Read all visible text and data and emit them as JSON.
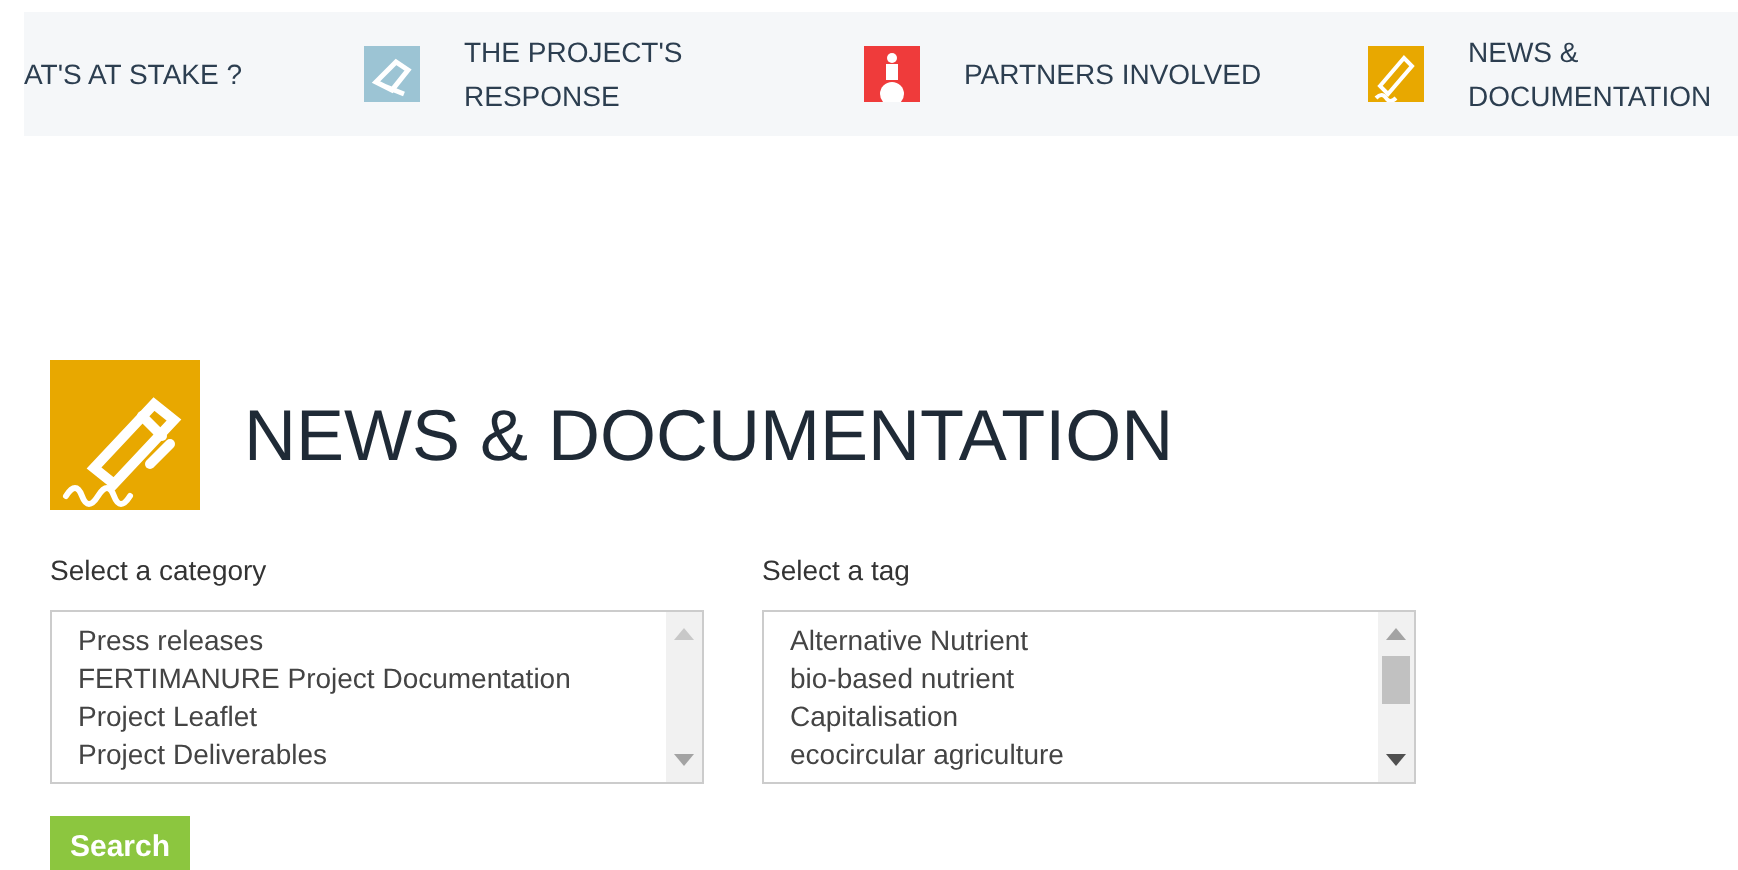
{
  "nav": [
    {
      "label": "AT'S AT STAKE ?"
    },
    {
      "label": "THE PROJECT'S RESPONSE",
      "color": "#9cc4d4"
    },
    {
      "label": "PARTNERS INVOLVED",
      "color": "#ef3b3b"
    },
    {
      "label": "NEWS & DOCUMENTATION",
      "color": "#e8a800"
    }
  ],
  "heading": "NEWS & DOCUMENTATION",
  "filters": [
    {
      "label": "Select a category",
      "options": [
        "Press releases",
        "FERTIMANURE Project Documentation",
        "Project Leaflet",
        "Project Deliverables"
      ]
    },
    {
      "label": "Select a tag",
      "options": [
        "Alternative Nutrient",
        "bio-based nutrient",
        "Capitalisation",
        "ecocircular agriculture"
      ]
    }
  ],
  "search_button": "Search"
}
